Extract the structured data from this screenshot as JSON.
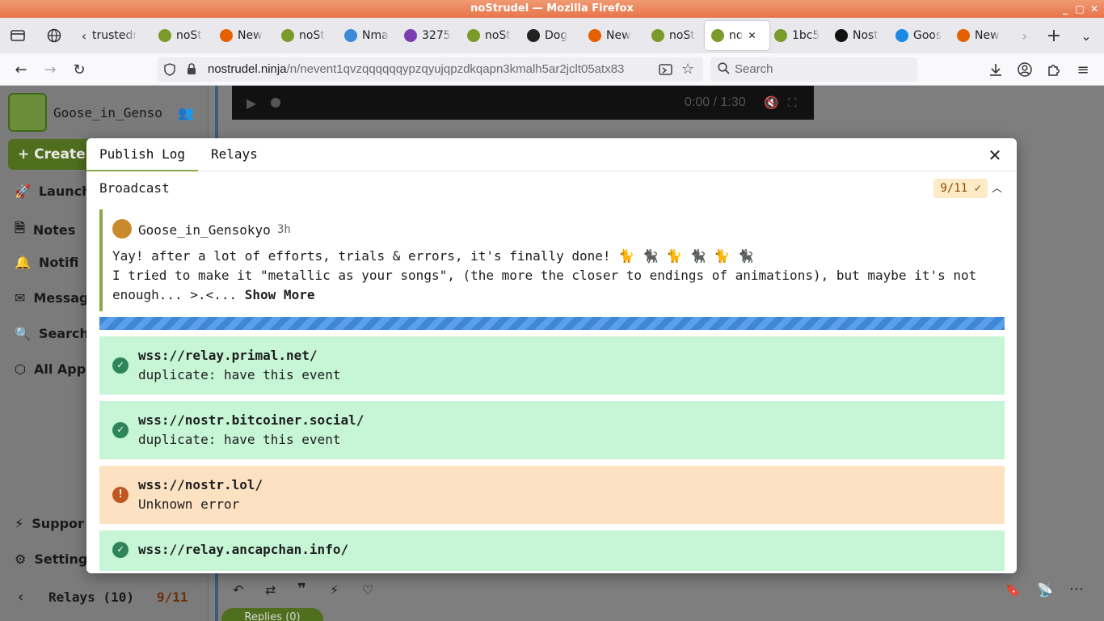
{
  "window": {
    "title": "noStrudel — Mozilla Firefox"
  },
  "tabs": [
    {
      "label": "trustedr",
      "color": "#777777"
    },
    {
      "label": "noSt",
      "color": "#7a9a2a"
    },
    {
      "label": "New",
      "color": "#e66000"
    },
    {
      "label": "noSt",
      "color": "#7a9a2a"
    },
    {
      "label": "Nma",
      "color": "#3a8ad8"
    },
    {
      "label": "3275",
      "color": "#7b3fb0"
    },
    {
      "label": "noSt",
      "color": "#7a9a2a"
    },
    {
      "label": "Dog",
      "color": "#222222"
    },
    {
      "label": "New",
      "color": "#e66000"
    },
    {
      "label": "noSt",
      "color": "#7a9a2a"
    },
    {
      "label": "no",
      "color": "#7a9a2a"
    },
    {
      "label": "1bc5",
      "color": "#7a9a2a"
    },
    {
      "label": "Nost",
      "color": "#111111"
    },
    {
      "label": "Goos",
      "color": "#1e88e5"
    },
    {
      "label": "New",
      "color": "#e66000"
    }
  ],
  "navbar": {
    "url_host": "nostrudel.ninja",
    "url_path": "/n/nevent1qvzqqqqqqypzqyujqpzdkqapn3kmalh5ar2jclt05atx83",
    "search_placeholder": "Search"
  },
  "app": {
    "username": "Goose_in_Genso",
    "create_label": "Create",
    "sidebar_items": [
      "Launchp",
      "Notes",
      "Notifi",
      "Messag",
      "Search",
      "All App",
      "Suppor",
      "Setting"
    ],
    "video_time": "0:00 / 1:30",
    "relays_footer": "Relays (10)",
    "relays_count": "9/11",
    "replies_label": "Replies (0)"
  },
  "modal": {
    "tabs": [
      "Publish Log",
      "Relays"
    ],
    "broadcast_title": "Broadcast",
    "badge": "9/11",
    "note": {
      "author": "Goose_in_Gensokyo",
      "time": "3h",
      "line1": "Yay! after a lot of efforts, trials & errors, it's finally done! 🐈 🐈‍⬛ 🐈 🐈‍⬛ 🐈 🐈‍⬛",
      "line2": "I tried to make it \"metallic as your songs\", (the more the closer to endings of animations), but maybe it's not",
      "line3": "enough... >.<...",
      "show_more": "Show More"
    },
    "progress": 0.82,
    "relays": [
      {
        "url": "wss://relay.primal.net/",
        "message": "duplicate: have this event",
        "status": "ok"
      },
      {
        "url": "wss://nostr.bitcoiner.social/",
        "message": "duplicate: have this event",
        "status": "ok"
      },
      {
        "url": "wss://nostr.lol/",
        "message": "Unknown error",
        "status": "error"
      },
      {
        "url": "wss://relay.ancapchan.info/",
        "message": "",
        "status": "ok"
      }
    ]
  }
}
